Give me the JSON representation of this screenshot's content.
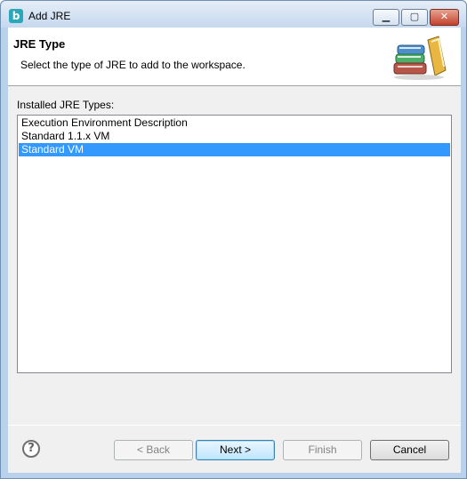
{
  "window": {
    "title": "Add JRE",
    "app_icon_letter": "b",
    "controls": {
      "minimize": "▁",
      "maximize": "▢",
      "close": "✕"
    }
  },
  "banner": {
    "title": "JRE Type",
    "description": "Select the type of JRE to add to the workspace.",
    "icon": "books-icon"
  },
  "list": {
    "label": "Installed JRE Types:",
    "items": [
      {
        "label": "Execution Environment Description",
        "selected": false
      },
      {
        "label": "Standard 1.1.x VM",
        "selected": false
      },
      {
        "label": "Standard VM",
        "selected": true
      }
    ]
  },
  "footer": {
    "help_symbol": "?",
    "back_label": "< Back",
    "next_label": "Next >",
    "finish_label": "Finish",
    "cancel_label": "Cancel"
  },
  "colors": {
    "selection": "#3399ff",
    "title_bar": "#c6d8ee",
    "dialog_bg": "#f0f0f0"
  }
}
